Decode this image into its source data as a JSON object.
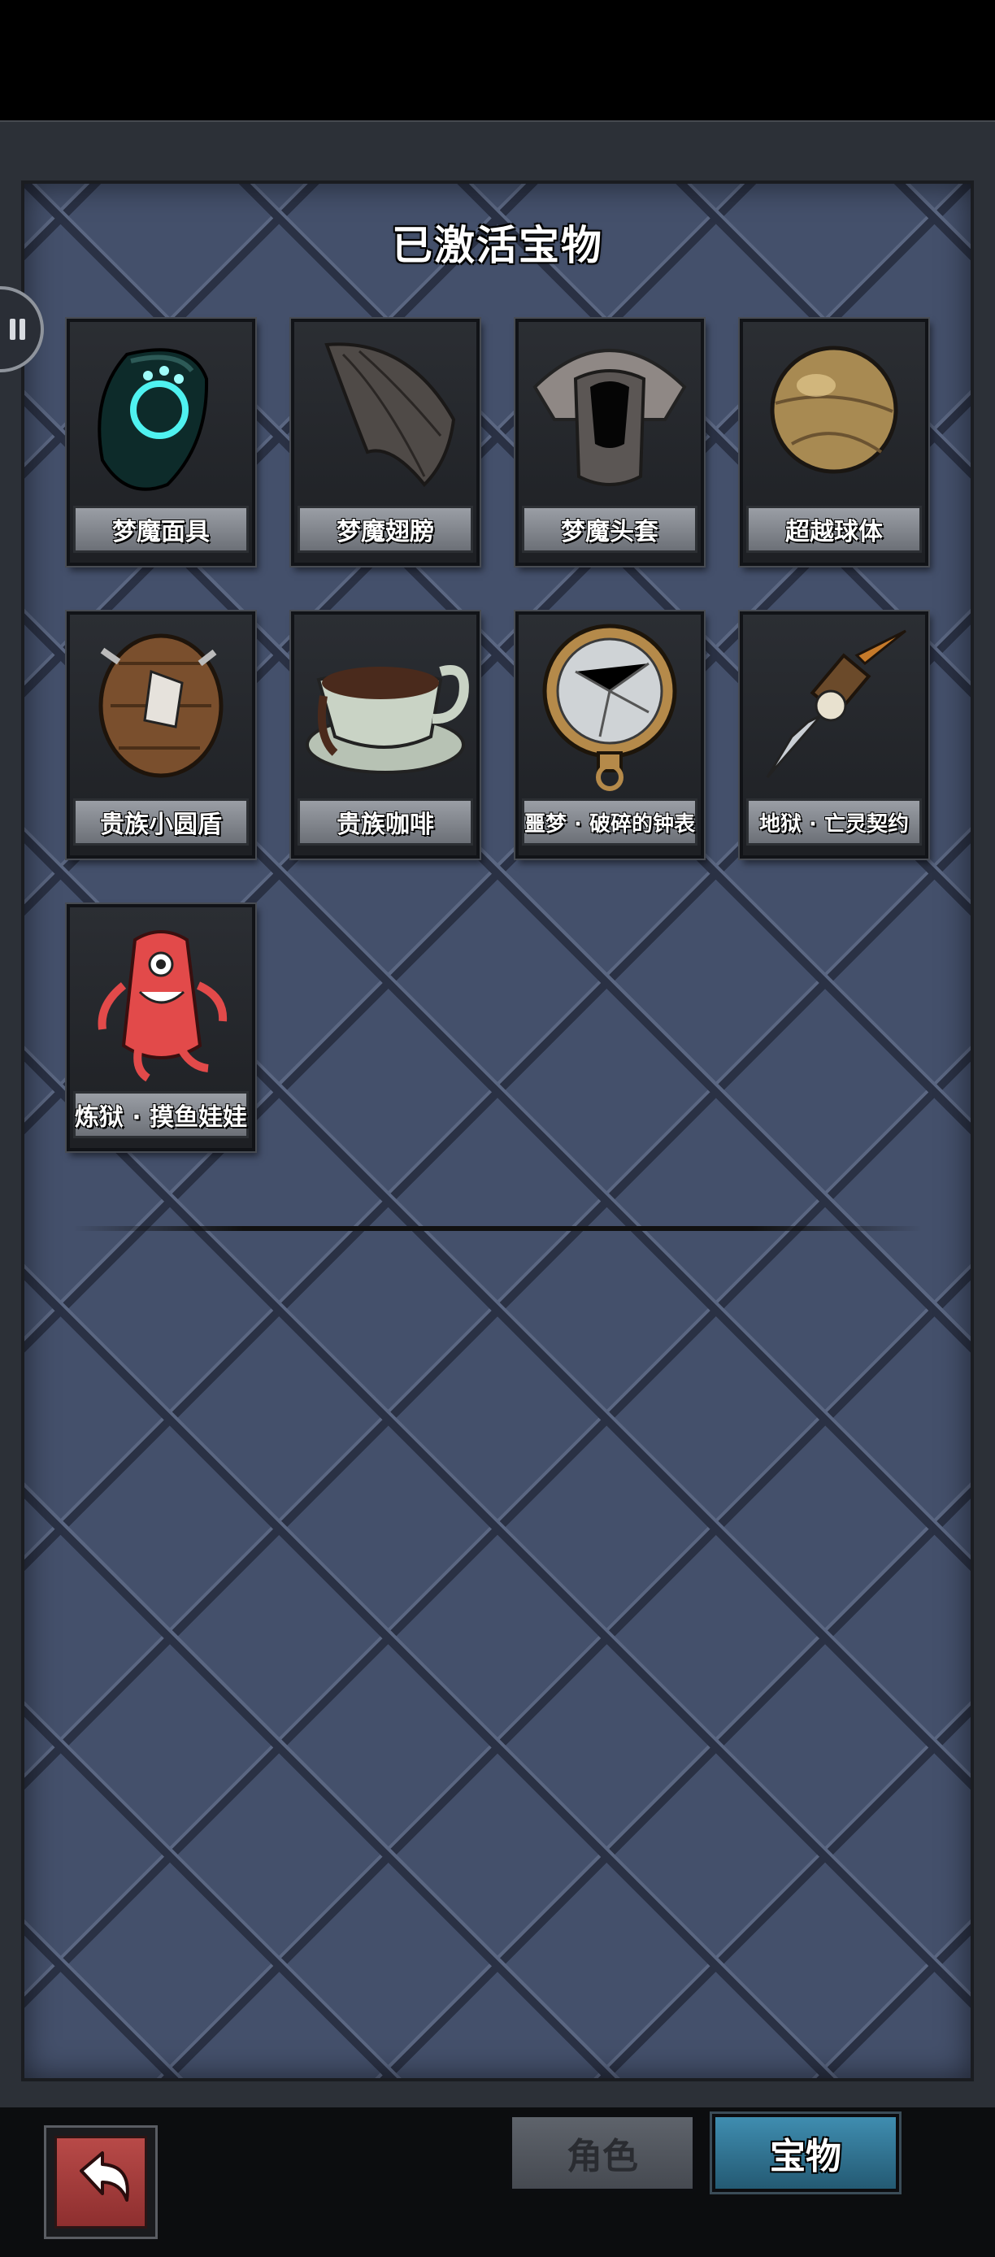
{
  "title": "已激活宝物",
  "items": [
    {
      "name": "梦魔面具",
      "icon": "mask-icon"
    },
    {
      "name": "梦魔翅膀",
      "icon": "wing-icon"
    },
    {
      "name": "梦魔头套",
      "icon": "helmet-icon"
    },
    {
      "name": "超越球体",
      "icon": "sphere-icon"
    },
    {
      "name": "贵族小圆盾",
      "icon": "shield-icon"
    },
    {
      "name": "贵族咖啡",
      "icon": "coffee-cup-icon"
    },
    {
      "name": "噩梦 · 破碎的钟表",
      "icon": "broken-watch-icon"
    },
    {
      "name": "地狱 · 亡灵契约",
      "icon": "skull-dagger-icon"
    },
    {
      "name": "炼狱 · 摸鱼娃娃",
      "icon": "red-doll-icon"
    }
  ],
  "bottom": {
    "back_icon": "return-arrow-icon",
    "tab_role": "角色",
    "tab_treasure": "宝物",
    "active_tab": "宝物"
  },
  "colors": {
    "active_tab": "#3f8db0",
    "back_button": "#b84a48",
    "panel": "#44506b"
  }
}
